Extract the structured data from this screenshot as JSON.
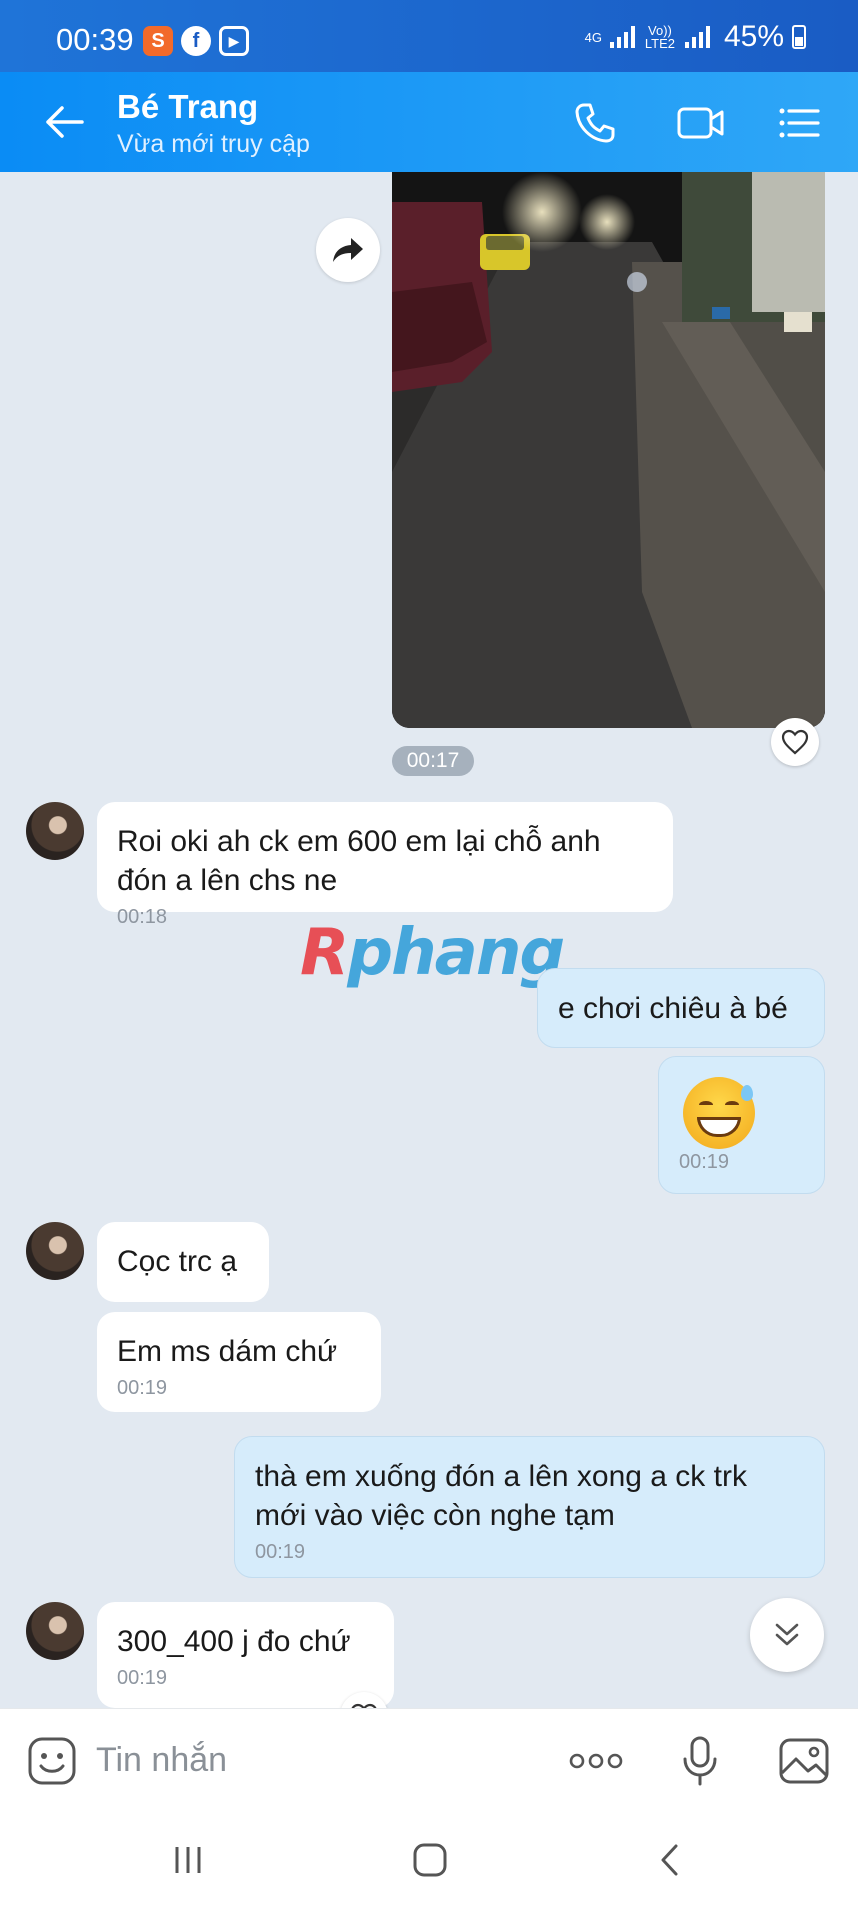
{
  "status_bar": {
    "time": "00:39",
    "network_top": "4G",
    "network_volte": "Vo)) LTE2",
    "battery_pct": "45%"
  },
  "header": {
    "contact_name": "Bé Trang",
    "contact_status": "Vừa mới truy cập",
    "icons": [
      "back-arrow-icon",
      "phone-call-icon",
      "video-call-icon",
      "menu-list-icon"
    ]
  },
  "messages": {
    "image_time": "00:17",
    "m1_text": "Roi oki ah ck em 600 em lại chỗ anh đón a lên chs ne",
    "m1_time": "00:18",
    "m2_text": "e chơi chiêu à bé",
    "m3_time": "00:19",
    "m4_text": "Cọc trc ạ",
    "m5_text": "Em ms dám chứ",
    "m5_time": "00:19",
    "m6_text": "thà em xuống đón a lên xong a ck trk mới vào việc còn nghe tạm",
    "m6_time": "00:19",
    "m7_text": "300_400 j đo chứ",
    "m7_time": "00:19"
  },
  "watermark": {
    "part1": "R",
    "part2": "phang"
  },
  "input_bar": {
    "placeholder": "Tin nhắn",
    "icons": [
      "sticker-icon",
      "more-dots-icon",
      "microphone-icon",
      "gallery-icon"
    ]
  },
  "colors": {
    "header_blue": "#0a8cf5",
    "outgoing_bubble": "#d6ecfb",
    "incoming_bubble": "#ffffff",
    "chat_background": "#e2e9f1"
  }
}
